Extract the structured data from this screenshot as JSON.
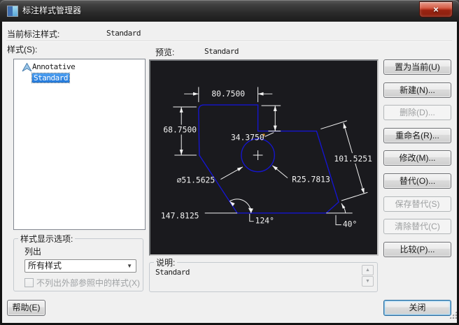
{
  "window": {
    "title": "标注样式管理器",
    "close_glyph": "×"
  },
  "header": {
    "current_style_label": "当前标注样式:",
    "current_style_value": "Standard"
  },
  "styles_panel": {
    "label": "样式(S):",
    "items": [
      {
        "name": "Annotative"
      },
      {
        "name": "Standard"
      }
    ],
    "selected": "Standard"
  },
  "preview": {
    "label": "预览:",
    "value": "Standard",
    "dimensions": {
      "top": "80.7500",
      "left": "68.7500",
      "middle": "34.3750",
      "aligned": "101.5251",
      "diameter": "∅51.5625",
      "radius": "R25.7813",
      "bottom": "147.8125",
      "angle_left": "124°",
      "angle_right": "40°"
    },
    "colors": {
      "background": "#1a1a1e",
      "shape": "#1515cf",
      "dimension": "#f2f2f2"
    }
  },
  "actions": {
    "buttons": [
      {
        "label": "置为当前(U)",
        "enabled": true
      },
      {
        "label": "新建(N)...",
        "enabled": true
      },
      {
        "label": "删除(D)...",
        "enabled": false
      },
      {
        "label": "重命名(R)...",
        "enabled": true
      },
      {
        "label": "修改(M)...",
        "enabled": true
      },
      {
        "label": "替代(O)...",
        "enabled": true
      },
      {
        "label": "保存替代(S)",
        "enabled": false
      },
      {
        "label": "清除替代(C)",
        "enabled": false
      },
      {
        "label": "比较(P)...",
        "enabled": true
      }
    ]
  },
  "display_options": {
    "legend": "样式显示选项:",
    "list_label": "列出",
    "list_value": "所有样式",
    "xref_checkbox_label": "不列出外部参照中的样式(X)",
    "xref_checkbox_checked": false
  },
  "description": {
    "legend": "说明:",
    "value": "Standard"
  },
  "footer": {
    "help_label": "帮助(E)",
    "close_label": "关闭"
  }
}
